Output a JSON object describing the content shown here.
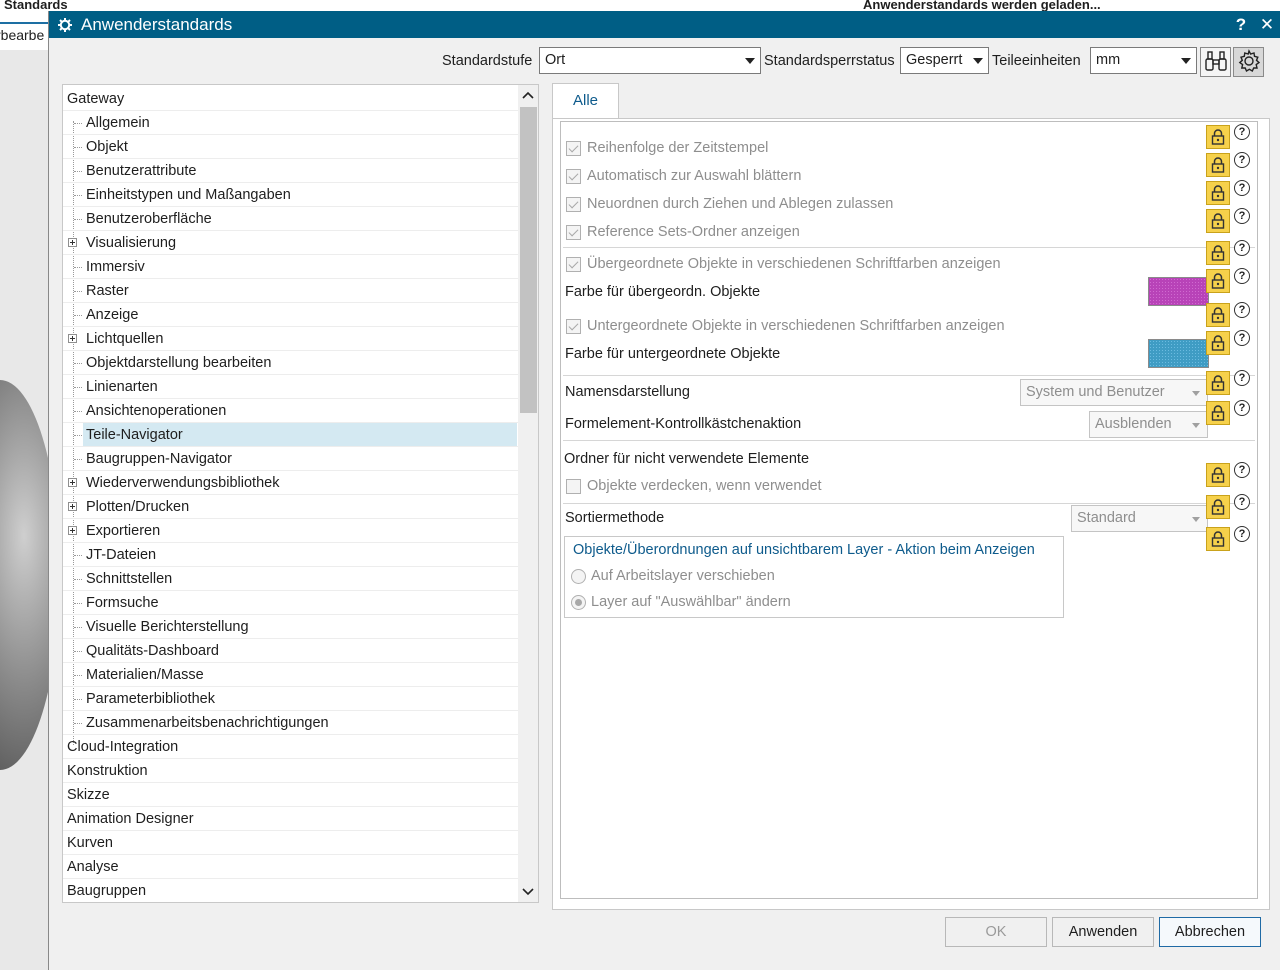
{
  "background": {
    "title_left": "Standards",
    "title_right": "Anwenderstandards werden geladen...",
    "tab_label": "rbearbe"
  },
  "dialog": {
    "title": "Anwenderstandards",
    "help_label": "?",
    "close_label": "✕",
    "title_color": "#005e85"
  },
  "toolbar": {
    "level_label": "Standardstufe",
    "level_value": "Ort",
    "lock_status_label": "Standardsperrstatus",
    "lock_status_value": "Gesperrt",
    "units_label": "Teileeinheiten",
    "units_value": "mm"
  },
  "tree": {
    "items": [
      {
        "label": "Gateway",
        "level": 0,
        "expandable": false
      },
      {
        "label": "Allgemein",
        "level": 1,
        "expandable": false
      },
      {
        "label": "Objekt",
        "level": 1,
        "expandable": false
      },
      {
        "label": "Benutzerattribute",
        "level": 1,
        "expandable": false
      },
      {
        "label": "Einheitstypen und Maßangaben",
        "level": 1,
        "expandable": false
      },
      {
        "label": "Benutzeroberfläche",
        "level": 1,
        "expandable": false
      },
      {
        "label": "Visualisierung",
        "level": 1,
        "expandable": true
      },
      {
        "label": "Immersiv",
        "level": 1,
        "expandable": false
      },
      {
        "label": "Raster",
        "level": 1,
        "expandable": false
      },
      {
        "label": "Anzeige",
        "level": 1,
        "expandable": false
      },
      {
        "label": "Lichtquellen",
        "level": 1,
        "expandable": true
      },
      {
        "label": "Objektdarstellung bearbeiten",
        "level": 1,
        "expandable": false
      },
      {
        "label": "Linienarten",
        "level": 1,
        "expandable": false
      },
      {
        "label": "Ansichtenoperationen",
        "level": 1,
        "expandable": false
      },
      {
        "label": "Teile-Navigator",
        "level": 1,
        "expandable": false,
        "selected": true
      },
      {
        "label": "Baugruppen-Navigator",
        "level": 1,
        "expandable": false
      },
      {
        "label": "Wiederverwendungsbibliothek",
        "level": 1,
        "expandable": true
      },
      {
        "label": "Plotten/Drucken",
        "level": 1,
        "expandable": true
      },
      {
        "label": "Exportieren",
        "level": 1,
        "expandable": true
      },
      {
        "label": "JT-Dateien",
        "level": 1,
        "expandable": false
      },
      {
        "label": "Schnittstellen",
        "level": 1,
        "expandable": false
      },
      {
        "label": "Formsuche",
        "level": 1,
        "expandable": false
      },
      {
        "label": "Visuelle Berichterstellung",
        "level": 1,
        "expandable": false
      },
      {
        "label": "Qualitäts-Dashboard",
        "level": 1,
        "expandable": false
      },
      {
        "label": "Materialien/Masse",
        "level": 1,
        "expandable": false
      },
      {
        "label": "Parameterbibliothek",
        "level": 1,
        "expandable": false
      },
      {
        "label": "Zusammenarbeitsbenachrichtigungen",
        "level": 1,
        "expandable": false
      },
      {
        "label": "Cloud-Integration",
        "level": 0,
        "expandable": false
      },
      {
        "label": "Konstruktion",
        "level": 0,
        "expandable": false
      },
      {
        "label": "Skizze",
        "level": 0,
        "expandable": false
      },
      {
        "label": "Animation Designer",
        "level": 0,
        "expandable": false
      },
      {
        "label": "Kurven",
        "level": 0,
        "expandable": false
      },
      {
        "label": "Analyse",
        "level": 0,
        "expandable": false
      },
      {
        "label": "Baugruppen",
        "level": 0,
        "expandable": false
      }
    ]
  },
  "panel": {
    "tab_label": "Alle",
    "options": {
      "timestamp_order": {
        "label": "Reihenfolge der Zeitstempel",
        "checked": true
      },
      "auto_scroll": {
        "label": "Automatisch zur Auswahl blättern",
        "checked": true
      },
      "drag_drop": {
        "label": "Neuordnen durch Ziehen und Ablegen zulassen",
        "checked": true
      },
      "ref_sets": {
        "label": "Reference Sets-Ordner anzeigen",
        "checked": true
      },
      "parent_colors": {
        "label": "Übergeordnete Objekte in verschiedenen Schriftfarben anzeigen",
        "checked": true
      },
      "child_colors": {
        "label": "Untergeordnete Objekte in verschiedenen Schriftfarben anzeigen",
        "checked": true
      },
      "hide_used": {
        "label": "Objekte verdecken, wenn verwendet",
        "checked": false
      }
    },
    "parent_color_label": "Farbe für übergeordn. Objekte",
    "parent_color": "#b843b8",
    "child_color_label": "Farbe für untergeordnete Objekte",
    "child_color": "#3f9cc4",
    "name_display_label": "Namensdarstellung",
    "name_display_value": "System und Benutzer",
    "feature_checkbox_label": "Formelement-Kontrollkästchenaktion",
    "feature_checkbox_value": "Ausblenden",
    "unused_folder_label": "Ordner für nicht verwendete Elemente",
    "sort_label": "Sortiermethode",
    "sort_value": "Standard",
    "layer_group": {
      "title": "Objekte/Überordnungen auf unsichtbarem Layer - Aktion beim Anzeigen",
      "options": [
        {
          "label": "Auf Arbeitslayer verschieben",
          "checked": false
        },
        {
          "label": "Layer auf \"Auswählbar\" ändern",
          "checked": true
        }
      ]
    },
    "lock_color": "#f6d14b"
  },
  "buttons": {
    "ok": "OK",
    "apply": "Anwenden",
    "cancel": "Abbrechen"
  }
}
